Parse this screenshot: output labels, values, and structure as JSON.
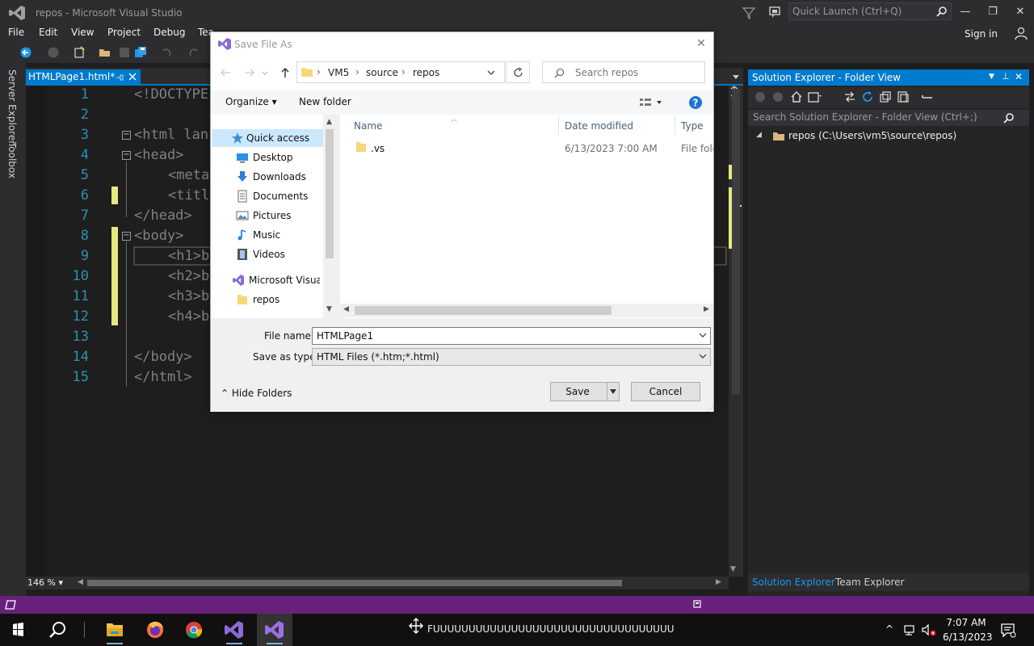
{
  "window": {
    "title": "repos - Microsoft Visual Studio",
    "quick_launch_placeholder": "Quick Launch (Ctrl+Q)",
    "sign_in": "Sign in"
  },
  "menu": [
    "File",
    "Edit",
    "View",
    "Project",
    "Debug",
    "Tea"
  ],
  "side_tabs": [
    "Server Explorer",
    "Toolbox"
  ],
  "doc_tab": {
    "label": "HTMLPage1.html*"
  },
  "editor": {
    "line_numbers": [
      "1",
      "2",
      "3",
      "4",
      "5",
      "6",
      "7",
      "8",
      "9",
      "10",
      "11",
      "12",
      "13",
      "14",
      "15"
    ],
    "lines": [
      "<!DOCTYPE",
      "",
      "<html lan",
      "<head>",
      "<meta",
      "<titl",
      "</head>",
      "<body>",
      "<h1>b",
      "<h2>b",
      "<h3>b",
      "<h4>b",
      "",
      "</body>",
      "</html>"
    ],
    "zoom": "146 %"
  },
  "solution_explorer": {
    "title": "Solution Explorer - Folder View",
    "search_placeholder": "Search Solution Explorer - Folder View (Ctrl+;)",
    "root_item": "repos (C:\\Users\\vm5\\source\\repos)",
    "tabs": [
      "Solution Explorer",
      "Team Explorer"
    ]
  },
  "dialog": {
    "title": "Save File As",
    "breadcrumbs": [
      "VM5",
      "source",
      "repos"
    ],
    "search_placeholder": "Search repos",
    "organize_label": "Organize",
    "new_folder_label": "New folder",
    "nav_items": [
      {
        "label": "Quick access",
        "icon": "star-icon"
      },
      {
        "label": "Desktop",
        "icon": "desktop-icon"
      },
      {
        "label": "Downloads",
        "icon": "download-icon"
      },
      {
        "label": "Documents",
        "icon": "documents-icon"
      },
      {
        "label": "Pictures",
        "icon": "pictures-icon"
      },
      {
        "label": "Music",
        "icon": "music-icon"
      },
      {
        "label": "Videos",
        "icon": "videos-icon"
      },
      {
        "label": "Microsoft Visual S",
        "icon": "visual-studio-icon"
      },
      {
        "label": "repos",
        "icon": "folder-icon"
      }
    ],
    "columns": [
      "Name",
      "Date modified",
      "Type"
    ],
    "files": [
      {
        "name": ".vs",
        "date": "6/13/2023 7:00 AM",
        "type": "File fold"
      }
    ],
    "file_name_label": "File name:",
    "file_name_value": "HTMLPage1",
    "save_type_label": "Save as type:",
    "save_type_value": "HTML Files (*.htm;*.html)",
    "hide_folders_label": "Hide Folders",
    "save_label": "Save",
    "cancel_label": "Cancel"
  },
  "taskbar": {
    "task_text": "FUUUUUUUUUUUUUUUUUUUUUUUUUUUUUUUUUU",
    "time": "7:07 AM",
    "date": "6/13/2023"
  },
  "colors": {
    "accent": "#007acc",
    "status_bar": "#68217a",
    "change_marker": "#e8e87e"
  }
}
